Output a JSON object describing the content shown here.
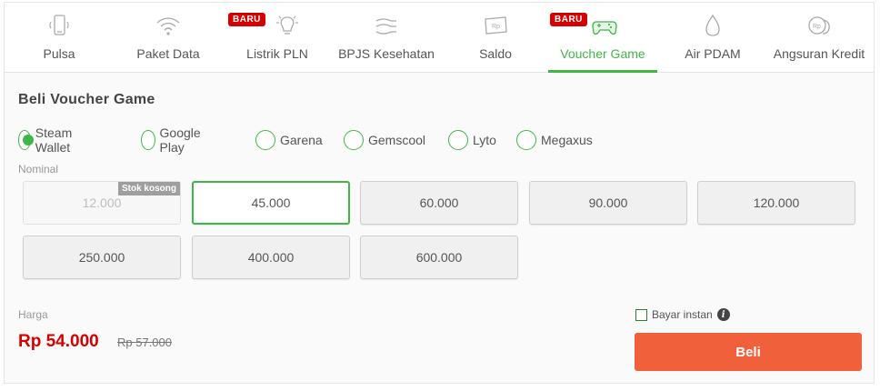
{
  "tabs": [
    {
      "label": "Pulsa",
      "icon": "phone-icon"
    },
    {
      "label": "Paket Data",
      "icon": "wifi-icon"
    },
    {
      "label": "Listrik PLN",
      "icon": "lightbulb-icon",
      "badge": "BARU"
    },
    {
      "label": "BPJS Kesehatan",
      "icon": "hands-icon"
    },
    {
      "label": "Saldo",
      "icon": "rupiah-note-icon"
    },
    {
      "label": "Voucher Game",
      "icon": "gamepad-icon",
      "badge": "BARU",
      "active": true
    },
    {
      "label": "Air PDAM",
      "icon": "water-drop-icon"
    },
    {
      "label": "Angsuran Kredit",
      "icon": "coins-icon"
    }
  ],
  "section_title": "Beli Voucher Game",
  "providers": [
    {
      "label": "Steam Wallet",
      "checked": true
    },
    {
      "label": "Google Play",
      "checked": false
    },
    {
      "label": "Garena",
      "checked": false
    },
    {
      "label": "Gemscool",
      "checked": false
    },
    {
      "label": "Lyto",
      "checked": false
    },
    {
      "label": "Megaxus",
      "checked": false
    }
  ],
  "nominal_label": "Nominal",
  "nominals": [
    {
      "label": "12.000",
      "state": "disabled",
      "tag": "Stok kosong"
    },
    {
      "label": "45.000",
      "state": "selected"
    },
    {
      "label": "60.000",
      "state": "normal"
    },
    {
      "label": "90.000",
      "state": "normal"
    },
    {
      "label": "120.000",
      "state": "normal"
    },
    {
      "label": "250.000",
      "state": "normal"
    },
    {
      "label": "400.000",
      "state": "normal"
    },
    {
      "label": "600.000",
      "state": "normal"
    }
  ],
  "price": {
    "label": "Harga",
    "current": "Rp 54.000",
    "original": "Rp 57.000"
  },
  "instant": {
    "label": "Bayar instan",
    "checked": false
  },
  "buy_button": "Beli",
  "colors": {
    "accent": "#42b549",
    "price": "#d50000",
    "buy": "#f0603a",
    "badge": "#d50000"
  }
}
